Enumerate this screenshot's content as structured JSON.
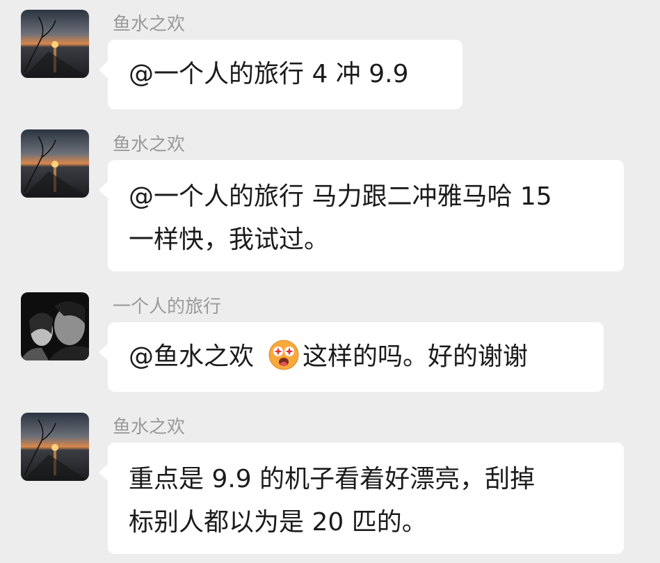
{
  "messages": [
    {
      "sender": "鱼水之欢",
      "avatar": "sunset-avatar",
      "lines": [
        "@一个人的旅行  4 冲 9.9"
      ]
    },
    {
      "sender": "鱼水之欢",
      "avatar": "sunset-avatar",
      "lines": [
        "@一个人的旅行  马力跟二冲雅马哈 15",
        "一样快，我试过。"
      ]
    },
    {
      "sender": "一个人的旅行",
      "avatar": "portrait-avatar",
      "mention": "@鱼水之欢",
      "emoji": "astonished-face-emoji",
      "text_after_emoji": "这样的吗。好的谢谢"
    },
    {
      "sender": "鱼水之欢",
      "avatar": "sunset-avatar",
      "lines": [
        "重点是 9.9 的机子看着好漂亮，刮掉",
        "标别人都以为是 20 匹的。"
      ]
    }
  ],
  "colors": {
    "background": "#ededed",
    "bubble": "#ffffff",
    "name": "#9a9a9a",
    "text": "#1b1b1b"
  }
}
